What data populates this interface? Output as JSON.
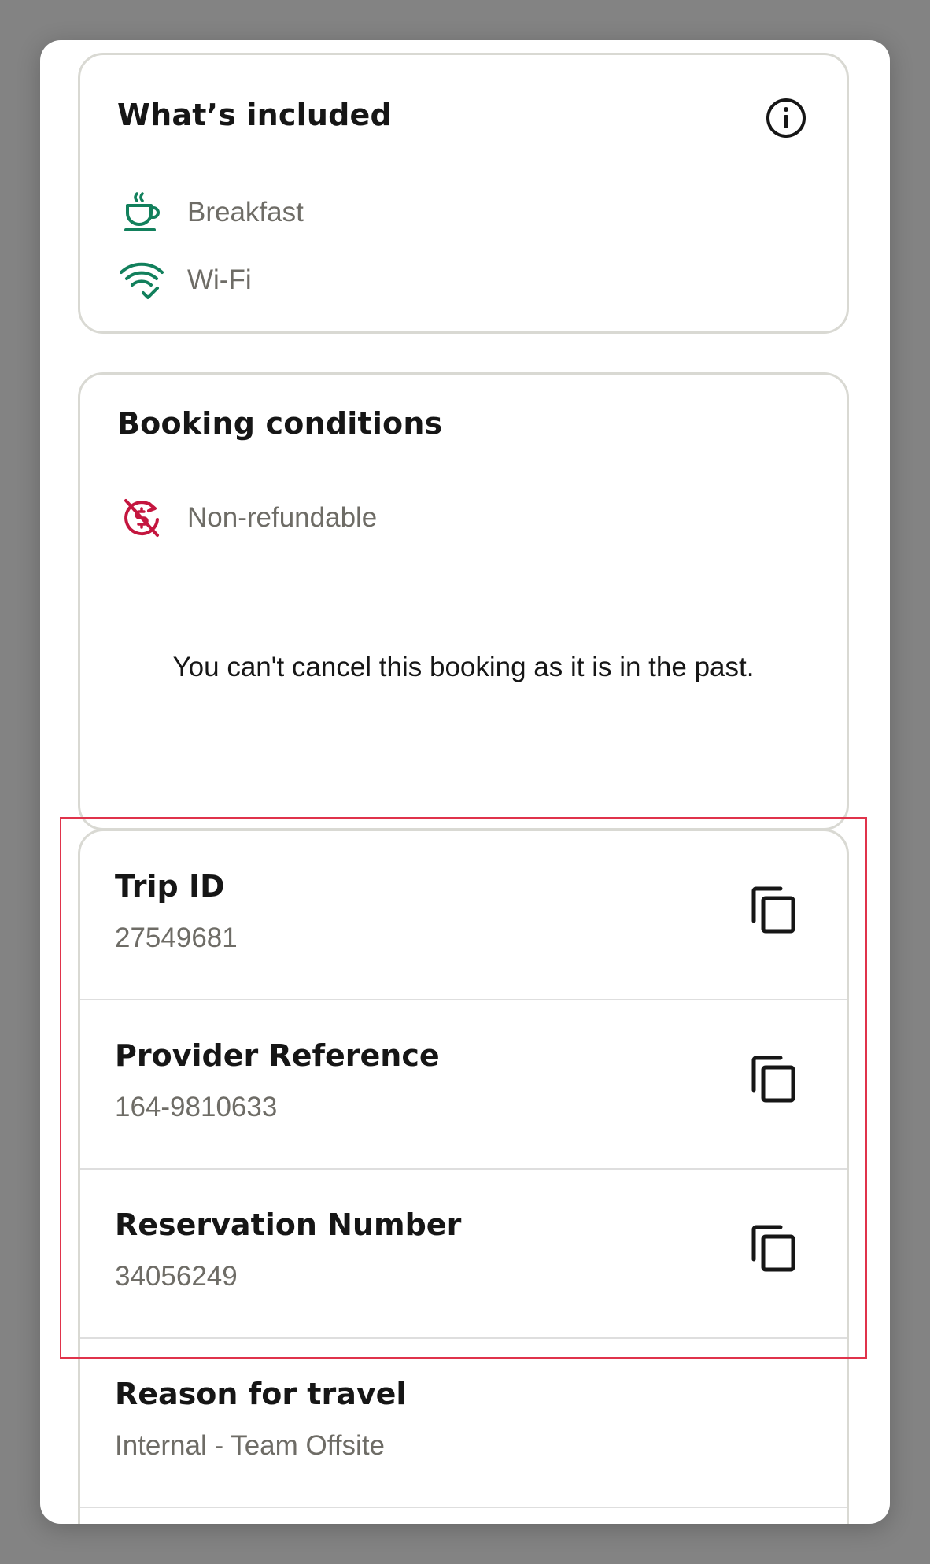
{
  "whats_included": {
    "title": "What’s included",
    "items": [
      {
        "label": "Breakfast",
        "icon": "coffee-cup-icon"
      },
      {
        "label": "Wi-Fi",
        "icon": "wifi-check-icon"
      }
    ],
    "info_icon": "info-icon"
  },
  "booking_conditions": {
    "title": "Booking conditions",
    "items": [
      {
        "label": "Non-refundable",
        "icon": "non-refundable-icon"
      }
    ],
    "note": "You can't cancel this booking as it is in the past."
  },
  "references": [
    {
      "label": "Trip ID",
      "value": "27549681",
      "copy_icon": "copy-icon"
    },
    {
      "label": "Provider Reference",
      "value": "164-9810633",
      "copy_icon": "copy-icon"
    },
    {
      "label": "Reservation Number",
      "value": "34056249",
      "copy_icon": "copy-icon"
    },
    {
      "label": "Reason for travel",
      "value": "Internal - Team Offsite"
    }
  ],
  "colors": {
    "included_icon": "#12805c",
    "nonrefundable_icon": "#c4163f",
    "highlight_border": "#e0334b",
    "secondary_text": "#6e6c66"
  }
}
